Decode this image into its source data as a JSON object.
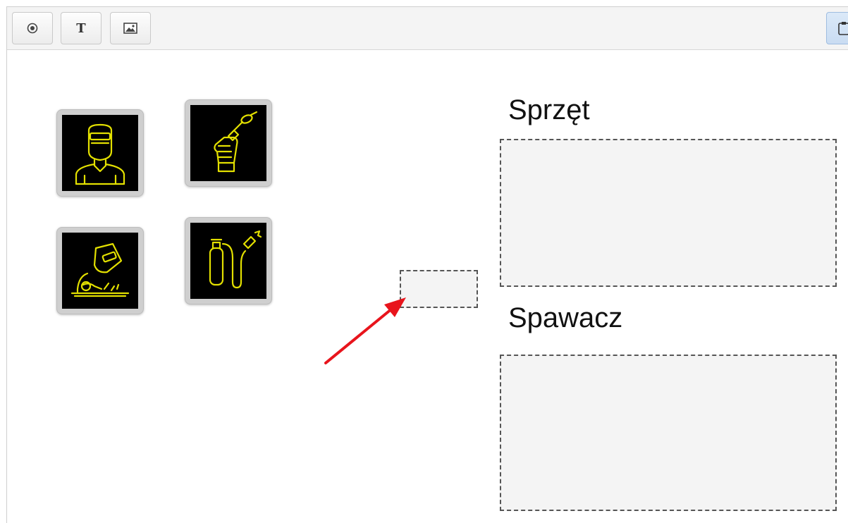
{
  "toolbar": {
    "buttons": [
      {
        "name": "target-icon"
      },
      {
        "name": "text-tool-icon",
        "label": "T"
      },
      {
        "name": "image-icon"
      }
    ],
    "right_button_icon": "paste-icon"
  },
  "tiles": [
    {
      "icon": "welder-with-mask-icon"
    },
    {
      "icon": "hand-holding-torch-icon"
    },
    {
      "icon": "welder-working-icon"
    },
    {
      "icon": "gas-cylinder-torch-icon"
    }
  ],
  "drop_targets": [
    {
      "label": "Sprzęt"
    },
    {
      "label": "Spawacz"
    }
  ],
  "colors": {
    "icon_stroke": "#e3e000",
    "arrow": "#e8141c"
  }
}
